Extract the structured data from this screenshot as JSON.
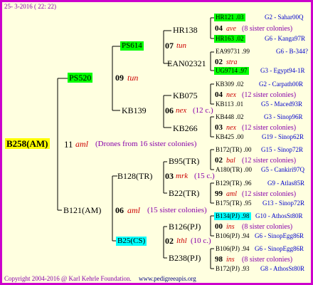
{
  "header": {
    "date": "25-  3-2016 ( 22: 22)"
  },
  "footer": {
    "copyright": "Copyright 2004-2016 @ Karl Kehrle Foundation.",
    "url": "www.pedigreeapis.org"
  },
  "colors": {
    "border": "#cc00cc",
    "background": "#ffffe0",
    "highlight_green": "#00ff00",
    "highlight_cyan": "#00ffff",
    "highlight_yellow": "#ffff00"
  },
  "root": {
    "id": "B258(AM)",
    "gen": "11",
    "breed": "aml",
    "note": "(Drones from 16 sister colonies)"
  },
  "sire": {
    "id": "PS520",
    "year": "09",
    "breed": "tun",
    "ss": {
      "id": "PS614",
      "year": "07",
      "breed": "tun",
      "sss": {
        "id": "HR138",
        "children": [
          {
            "id": "HR121 .03",
            "hl": "g",
            "right": "G2 - Sahar00Q"
          },
          {
            "id": "04",
            "breed": "ave",
            "right": "(8 sister colonies)"
          },
          {
            "id": "HR163 .02",
            "hl": "g",
            "right": "G6 - Kanga97R"
          }
        ]
      },
      "ssd": {
        "id": "EAN02321",
        "children": [
          {
            "id": "EA99731 .99",
            "right": "G6 - B-344?"
          },
          {
            "id": "02",
            "breed": "stra",
            "right": ""
          },
          {
            "id": "UG9714 .97",
            "hl": "g",
            "right": "G3 - Egypt94-1R"
          }
        ]
      }
    },
    "sd": {
      "id": "KB139",
      "year": "06",
      "breed": "nex",
      "note": "(12 c.)",
      "sds": {
        "id": "KB075",
        "children": [
          {
            "id": "KB309 .02",
            "right": "G2 - Carpath00R"
          },
          {
            "id": "04",
            "breed": "nex",
            "right": "(12 sister colonies)"
          },
          {
            "id": "KB113 .01",
            "right": "G5 - Maced93R"
          }
        ]
      },
      "sdd": {
        "id": "KB266",
        "children": [
          {
            "id": "KB448 .02",
            "right": "G3 - Sinop96R"
          },
          {
            "id": "03",
            "breed": "nex",
            "right": "(12 sister colonies)"
          },
          {
            "id": "KB425 .00",
            "right": "G19 - Sinop62R"
          }
        ]
      }
    }
  },
  "dam": {
    "id": "B121(AM)",
    "year": "06",
    "breed": "aml",
    "note": "(15 sister colonies)",
    "ds": {
      "id": "B128(TR)",
      "year": "03",
      "breed": "mrk",
      "note": "(15 c.)",
      "dss": {
        "id": "B95(TR)",
        "children": [
          {
            "id": "B172(TR) .00",
            "right": "G15 - Sinop72R"
          },
          {
            "id": "02",
            "breed": "bal",
            "right": "(12 sister colonies)"
          },
          {
            "id": "A180(TR) .00",
            "right": "G5 - Cankiri97Q"
          }
        ]
      },
      "dsd": {
        "id": "B22(TR)",
        "children": [
          {
            "id": "B129(TR) .96",
            "right": "G9 - Atlas85R"
          },
          {
            "id": "99",
            "breed": "aml",
            "right": "(12 sister colonies)"
          },
          {
            "id": "B175(TR) .95",
            "right": "G13 - Sinop72R"
          }
        ]
      }
    },
    "dd": {
      "id": "B25(CS)",
      "year": "02",
      "breed": "lthl",
      "note": "(10 c.)",
      "dds": {
        "id": "B126(PJ)",
        "children": [
          {
            "id": "B134(PJ) .98",
            "hl": "c",
            "right": "G10 - AthosSt80R"
          },
          {
            "id": "00",
            "breed": "ins",
            "right": "(8 sister colonies)"
          },
          {
            "id": "B106(PJ) .94",
            "right": "G6 - SinopEgg86R"
          }
        ]
      },
      "ddd": {
        "id": "B238(PJ)",
        "children": [
          {
            "id": "B106(PJ) .94",
            "right": "G6 - SinopEgg86R"
          },
          {
            "id": "98",
            "breed": "ins",
            "right": "(8 sister colonies)"
          },
          {
            "id": "B172(PJ) .93",
            "right": "G8 - AthosSt80R"
          }
        ]
      }
    }
  }
}
